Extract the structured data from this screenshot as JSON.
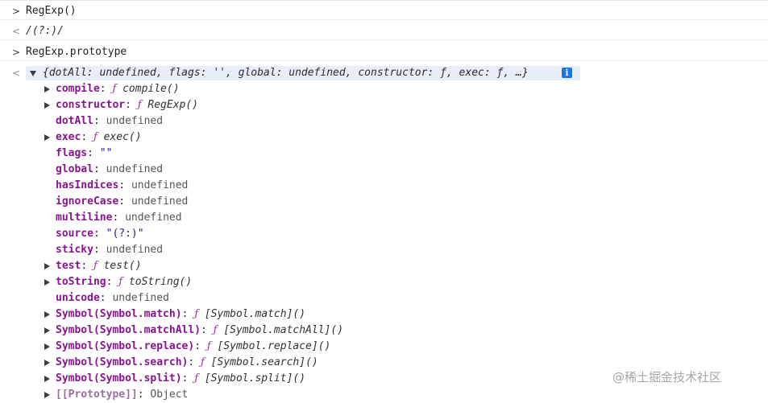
{
  "console": {
    "messages": [
      {
        "kind": "input",
        "prompt": ">",
        "text": "RegExp()"
      },
      {
        "kind": "output",
        "prompt": "<",
        "text": "/(?:)/"
      },
      {
        "kind": "input",
        "prompt": ">",
        "text": "RegExp.prototype"
      }
    ],
    "result": {
      "prompt": "<",
      "summary": "{dotAll: undefined, flags: '', global: undefined, constructor: ƒ, exec: ƒ, …}",
      "info_icon": "i",
      "colors": {
        "key": "#881391",
        "string": "#1a1aa6",
        "info": "#1a73e8"
      },
      "properties": [
        {
          "key": "compile",
          "expandable": true,
          "type": "fn",
          "fn": "ƒ",
          "value": "compile()"
        },
        {
          "key": "constructor",
          "expandable": true,
          "type": "fn",
          "fn": "ƒ",
          "value": "RegExp()"
        },
        {
          "key": "dotAll",
          "expandable": false,
          "type": "undef",
          "fn": "",
          "value": "undefined"
        },
        {
          "key": "exec",
          "expandable": true,
          "type": "fn",
          "fn": "ƒ",
          "value": "exec()"
        },
        {
          "key": "flags",
          "expandable": false,
          "type": "str",
          "fn": "",
          "value": "\"\""
        },
        {
          "key": "global",
          "expandable": false,
          "type": "undef",
          "fn": "",
          "value": "undefined"
        },
        {
          "key": "hasIndices",
          "expandable": false,
          "type": "undef",
          "fn": "",
          "value": "undefined"
        },
        {
          "key": "ignoreCase",
          "expandable": false,
          "type": "undef",
          "fn": "",
          "value": "undefined"
        },
        {
          "key": "multiline",
          "expandable": false,
          "type": "undef",
          "fn": "",
          "value": "undefined"
        },
        {
          "key": "source",
          "expandable": false,
          "type": "str",
          "fn": "",
          "value": "\"(?:)\""
        },
        {
          "key": "sticky",
          "expandable": false,
          "type": "undef",
          "fn": "",
          "value": "undefined"
        },
        {
          "key": "test",
          "expandable": true,
          "type": "fn",
          "fn": "ƒ",
          "value": "test()"
        },
        {
          "key": "toString",
          "expandable": true,
          "type": "fn",
          "fn": "ƒ",
          "value": "toString()"
        },
        {
          "key": "unicode",
          "expandable": false,
          "type": "undef",
          "fn": "",
          "value": "undefined"
        },
        {
          "key": "Symbol(Symbol.match)",
          "expandable": true,
          "type": "fn",
          "fn": "ƒ",
          "value": "[Symbol.match]()"
        },
        {
          "key": "Symbol(Symbol.matchAll)",
          "expandable": true,
          "type": "fn",
          "fn": "ƒ",
          "value": "[Symbol.matchAll]()"
        },
        {
          "key": "Symbol(Symbol.replace)",
          "expandable": true,
          "type": "fn",
          "fn": "ƒ",
          "value": "[Symbol.replace]()"
        },
        {
          "key": "Symbol(Symbol.search)",
          "expandable": true,
          "type": "fn",
          "fn": "ƒ",
          "value": "[Symbol.search]()"
        },
        {
          "key": "Symbol(Symbol.split)",
          "expandable": true,
          "type": "fn",
          "fn": "ƒ",
          "value": "[Symbol.split]()"
        },
        {
          "key": "[[Prototype]]",
          "expandable": true,
          "type": "plain",
          "fn": "",
          "value": "Object"
        }
      ]
    }
  },
  "watermark": "@稀土掘金技术社区"
}
